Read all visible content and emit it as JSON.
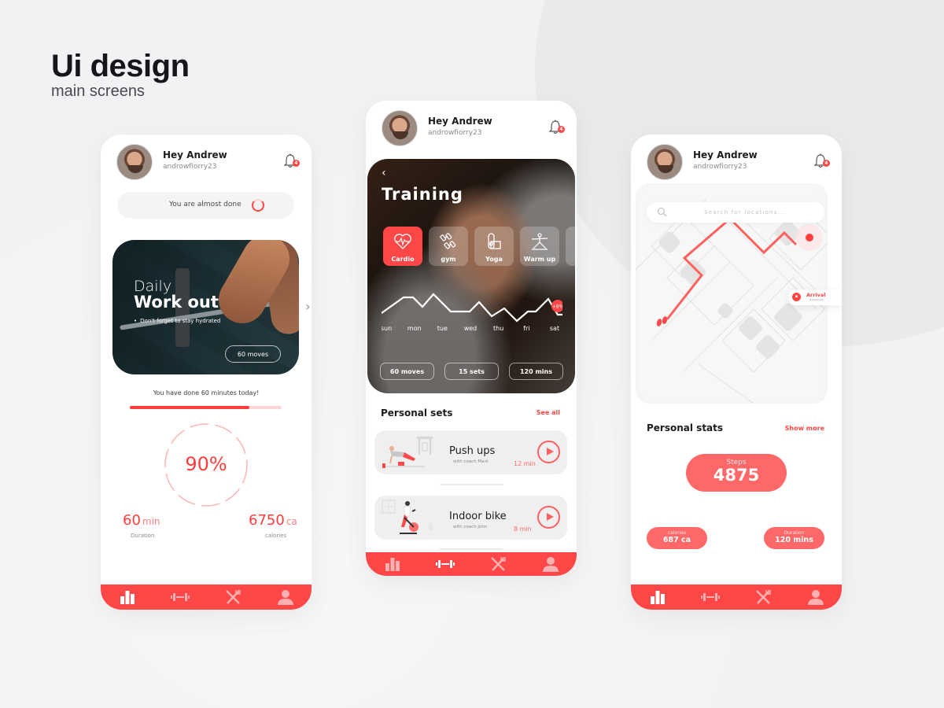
{
  "heading": {
    "title": "Ui design",
    "subtitle": "main screens"
  },
  "colors": {
    "accent": "#ff4747",
    "accent_soft": "#ff6868",
    "text": "#1d1d1f",
    "muted": "#8a8a90"
  },
  "user": {
    "greeting": "Hey Andrew",
    "username": "androwfiorry23",
    "notification_count": "4"
  },
  "nav": {
    "items": [
      {
        "icon": "bar-chart-icon",
        "label": "Stats"
      },
      {
        "icon": "dumbbell-icon",
        "label": "Workout"
      },
      {
        "icon": "fork-knife-icon",
        "label": "Diet"
      },
      {
        "icon": "user-icon",
        "label": "Profile"
      }
    ]
  },
  "screen1": {
    "status_text": "You are almost done",
    "daily": {
      "line1": "Daily",
      "line2": "Work out",
      "tip": "Don't forget to stay hydrated",
      "button": "60 moves"
    },
    "done_text": "You have done 60 minutes today!",
    "progress_fraction": 0.79,
    "percent": "90%",
    "percent_value": 0.9,
    "duration": {
      "value": "60",
      "unit": "min",
      "label": "Duration"
    },
    "calories": {
      "value": "6750",
      "unit": "ca",
      "label": "calories"
    }
  },
  "screen2": {
    "back_icon": "chevron-left-icon",
    "title": "Training",
    "categories": [
      {
        "label": "Cardio",
        "icon": "heart-pulse-icon",
        "active": true
      },
      {
        "label": "gym",
        "icon": "dumbbell-icon",
        "active": false
      },
      {
        "label": "Yoga",
        "icon": "yoga-mat-icon",
        "active": false
      },
      {
        "label": "Warm up",
        "icon": "stretch-pose-icon",
        "active": false
      }
    ],
    "week": {
      "days": [
        "sun",
        "mon",
        "tue",
        "wed",
        "thu",
        "fri",
        "sat"
      ],
      "badge": "+8%"
    },
    "pills": [
      "60 moves",
      "15 sets",
      "120 mins"
    ],
    "section_title": "Personal sets",
    "section_link": "See all",
    "sets": [
      {
        "name": "Push ups",
        "coach": "with coach Mark",
        "duration": "12 min"
      },
      {
        "name": "Indoor bike",
        "coach": "with coach John",
        "duration": "8 min"
      }
    ]
  },
  "screen3": {
    "search_placeholder": "Search for locations...",
    "arrival_label": "Arrival",
    "section_title": "Personal stats",
    "section_link": "Show more",
    "steps": {
      "label": "Steps",
      "value": "4875"
    },
    "calories": {
      "label": "calories",
      "value": "687 ca"
    },
    "duration": {
      "label": "Duration",
      "value": "120 mins"
    }
  }
}
